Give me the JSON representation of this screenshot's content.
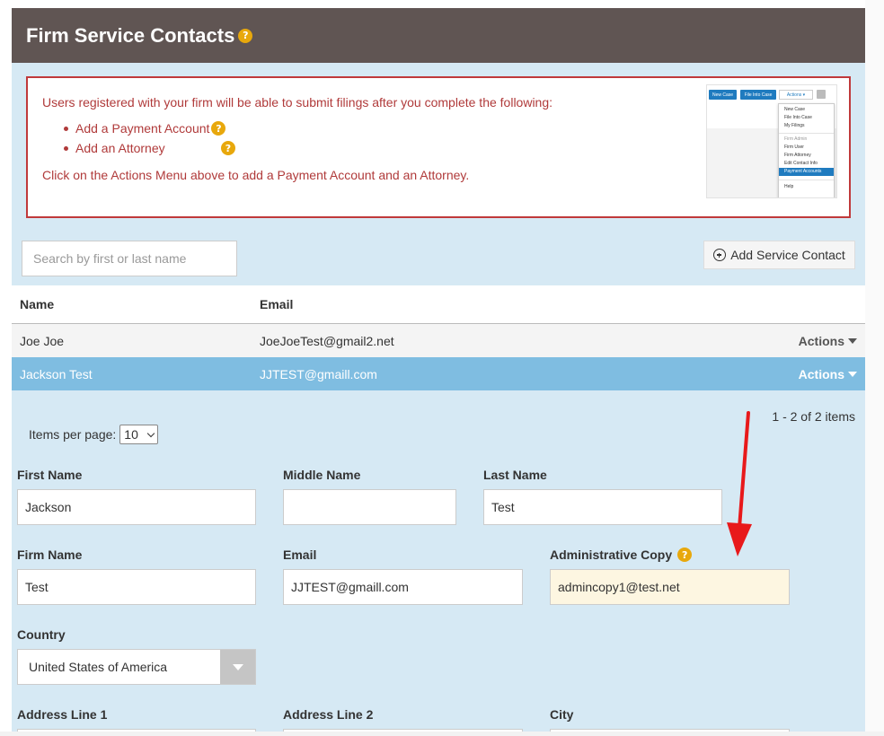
{
  "header": {
    "title": "Firm Service Contacts",
    "help_glyph": "?"
  },
  "notice": {
    "intro": "Users registered with your firm will be able to submit filings after you complete the following:",
    "items": [
      {
        "label": "Add a Payment Account",
        "help_glyph": "?"
      },
      {
        "label": "Add an Attorney",
        "help_glyph": "?"
      }
    ],
    "outro": "Click on the Actions Menu above to add a Payment Account and an Attorney."
  },
  "mini_screenshot": {
    "buttons": [
      "New Case",
      "File Into Case"
    ],
    "actions_label": "Actions",
    "menu_items": [
      "New Case",
      "File Into Case",
      "My Filings",
      "Firm Admin",
      "Firm User",
      "Firm Attorney",
      "Edit Contact Info",
      "Payment Accounts",
      "Help"
    ],
    "selected_item": "Payment Accounts"
  },
  "search": {
    "placeholder": "Search by first or last name"
  },
  "add_button": {
    "label": "Add Service Contact",
    "icon": "plus-circle-icon"
  },
  "grid": {
    "columns": [
      "Name",
      "Email"
    ],
    "rows": [
      {
        "name": "Joe Joe",
        "email": "JoeJoeTest@gmail2.net",
        "actions": "Actions"
      },
      {
        "name": "Jackson Test",
        "email": "JJTEST@gmaill.com",
        "actions": "Actions",
        "selected": true
      }
    ]
  },
  "pager": {
    "info": "1 - 2 of 2 items",
    "per_page_label": "Items per page:",
    "per_page_value": "10"
  },
  "form": {
    "first_name": {
      "label": "First Name",
      "value": "Jackson"
    },
    "middle_name": {
      "label": "Middle Name",
      "value": ""
    },
    "last_name": {
      "label": "Last Name",
      "value": "Test"
    },
    "firm_name": {
      "label": "Firm Name",
      "value": "Test"
    },
    "email": {
      "label": "Email",
      "value": "JJTEST@gmaill.com"
    },
    "admin_copy": {
      "label": "Administrative Copy",
      "value": "admincopy1@test.net",
      "help_glyph": "?"
    },
    "country": {
      "label": "Country",
      "value": "United States of America"
    },
    "address1": {
      "label": "Address Line 1",
      "value": ""
    },
    "address2": {
      "label": "Address Line 2",
      "value": ""
    },
    "city": {
      "label": "City",
      "value": ""
    }
  },
  "colors": {
    "header_bg": "#605553",
    "panel_bg": "#d6e9f4",
    "notice_red": "#c0393b",
    "help_badge": "#e8a80c",
    "selected_row": "#7fbde1",
    "highlight_field": "#fdf6e1",
    "annotation_arrow": "#e8191b"
  }
}
